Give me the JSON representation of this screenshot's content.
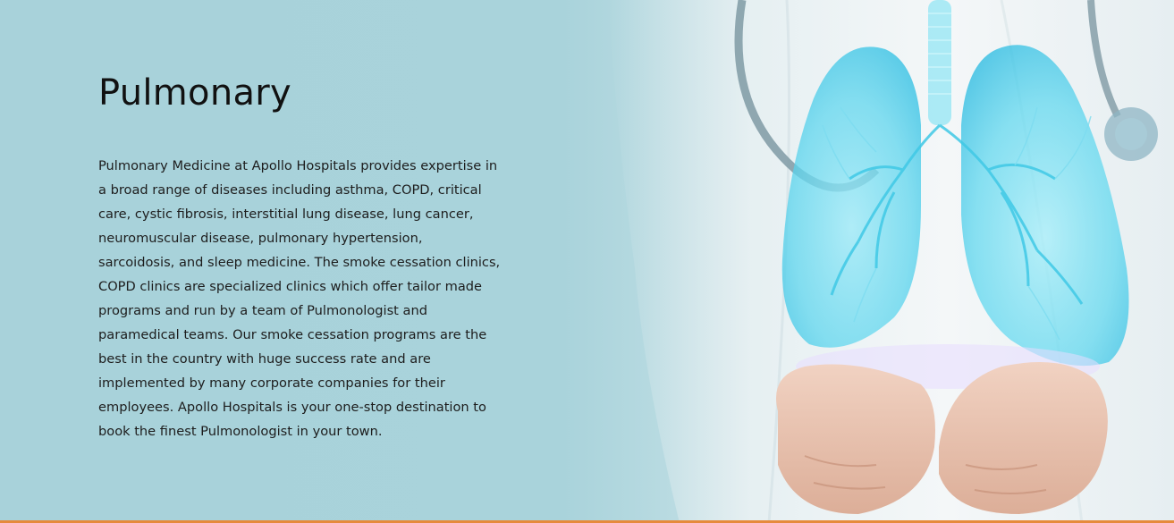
{
  "hero": {
    "title": "Pulmonary",
    "description": "Pulmonary Medicine at Apollo Hospitals provides expertise in a broad range of diseases including asthma, COPD, critical care, cystic fibrosis, interstitial lung disease, lung cancer, neuromuscular disease, pulmonary hypertension, sarcoidosis, and sleep medicine. The smoke cessation clinics, COPD clinics are specialized clinics which offer tailor made programs and run by a team of Pulmonologist and paramedical teams. Our smoke cessation programs are the best in the country with huge success rate and are implemented by many corporate companies for their employees. Apollo Hospitals is your one-stop destination to book the finest Pulmonologist in your town.",
    "image_icon": "doctor-holding-lungs-illustration"
  },
  "colors": {
    "background": "#a9d2da",
    "accent_bar": "#e68a3c",
    "lung": "#5fd6ee",
    "title_text": "#111111"
  }
}
